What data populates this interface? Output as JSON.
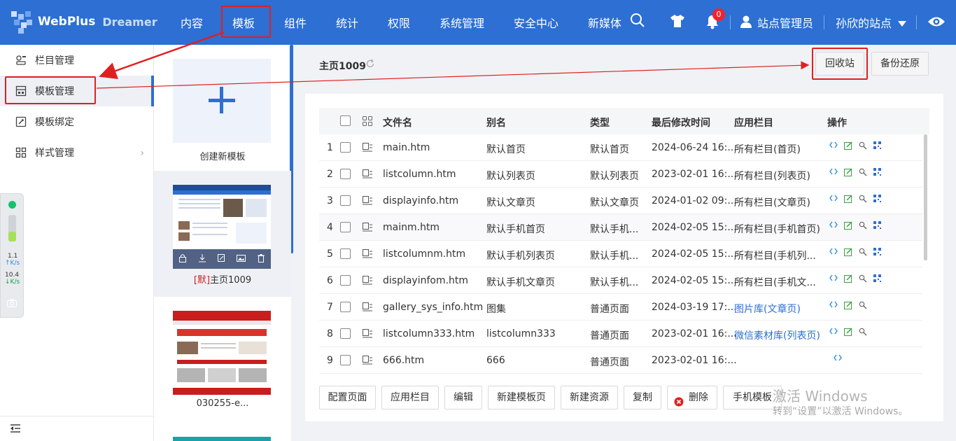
{
  "app": {
    "brand": "WebPlus",
    "brand_sub": "Dreamer"
  },
  "nav": {
    "items": [
      "内容",
      "模板",
      "组件",
      "统计",
      "权限",
      "系统管理",
      "安全中心",
      "新媒体"
    ],
    "active": "模板",
    "notification_count": "0",
    "user": "站点管理员",
    "site": "孙欣的站点"
  },
  "sidebar": {
    "items": [
      "栏目管理",
      "模板管理",
      "模板绑定",
      "样式管理"
    ],
    "active": "模板管理"
  },
  "net_widget": {
    "up": "1.1",
    "up_unit": "K/s",
    "down": "10.4",
    "down_unit": "K/s"
  },
  "templates": {
    "create_label": "创建新模板",
    "selected_prefix": "[默]",
    "selected_name": "主页1009",
    "second_name": "030255-e..."
  },
  "header": {
    "title": "主页1009",
    "recycle": "回收站",
    "backup": "备份还原"
  },
  "table": {
    "columns": [
      "文件名",
      "别名",
      "类型",
      "最后修改时间",
      "应用栏目",
      "操作"
    ],
    "rows": [
      {
        "n": "1",
        "file": "main.htm",
        "alias": "默认首页",
        "type": "默认首页",
        "time": "2024-06-24 16:...",
        "col": "所有栏目(首页)",
        "link": false
      },
      {
        "n": "2",
        "file": "listcolumn.htm",
        "alias": "默认列表页",
        "type": "默认列表页",
        "time": "2023-02-01 16:...",
        "col": "所有栏目(列表页)",
        "link": false
      },
      {
        "n": "3",
        "file": "displayinfo.htm",
        "alias": "默认文章页",
        "type": "默认文章页",
        "time": "2024-01-02 09:...",
        "col": "所有栏目(文章页)",
        "link": false
      },
      {
        "n": "4",
        "file": "mainm.htm",
        "alias": "默认手机首页",
        "type": "默认手机...",
        "time": "2024-02-05 15:...",
        "col": "所有栏目(手机首页)",
        "link": false
      },
      {
        "n": "5",
        "file": "listcolumnm.htm",
        "alias": "默认手机列表页",
        "type": "默认手机...",
        "time": "2024-02-05 15:...",
        "col": "所有栏目(手机列...",
        "link": false
      },
      {
        "n": "6",
        "file": "displayinfom.htm",
        "alias": "默认手机文章页",
        "type": "默认手机...",
        "time": "2024-02-05 15:...",
        "col": "所有栏目(手机文...",
        "link": false
      },
      {
        "n": "7",
        "file": "gallery_sys_info.htm",
        "alias": "图集",
        "type": "普通页面",
        "time": "2024-03-19 17:...",
        "col": "图片库(文章页)",
        "link": true
      },
      {
        "n": "8",
        "file": "listcolumn333.htm",
        "alias": "listcolumn333",
        "type": "普通页面",
        "time": "2023-02-01 16:...",
        "col": "微信素材库(列表页)",
        "link": true
      },
      {
        "n": "9",
        "file": "666.htm",
        "alias": "666",
        "type": "普通页面",
        "time": "2023-02-01 16:...",
        "col": "",
        "link": false
      }
    ]
  },
  "toolbar": [
    "配置页面",
    "应用栏目",
    "编辑",
    "新建模板页",
    "新建资源",
    "复制",
    "删除",
    "手机模板"
  ],
  "watermark": {
    "line1": "激活 Windows",
    "line2": "转到“设置”以激活 Windows。"
  },
  "colors": {
    "primary": "#2d6fd2",
    "highlight": "#e02020",
    "link": "#2d6fd2"
  }
}
